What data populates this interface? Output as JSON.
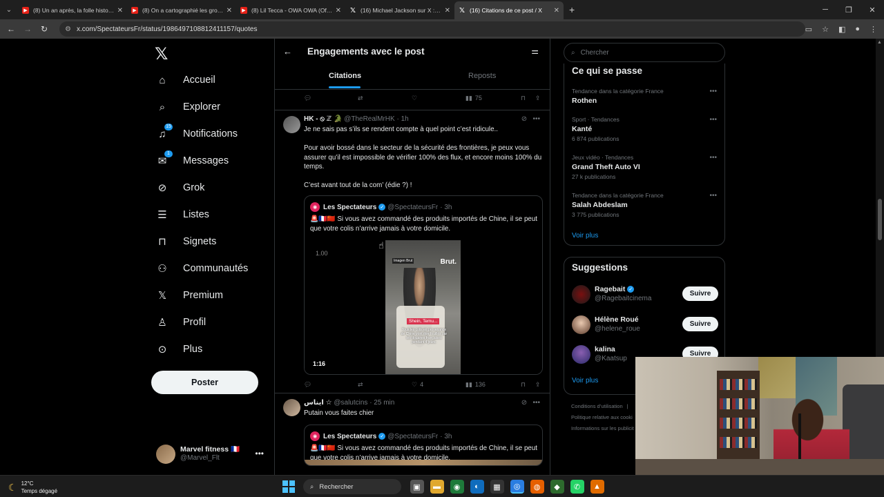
{
  "browser": {
    "tabs": [
      {
        "title": "(8) Un an après, la folle histoire",
        "icon": "youtube-icon"
      },
      {
        "title": "(8) On a cartographié les group",
        "icon": "youtube-icon"
      },
      {
        "title": "(8) Lil Tecca - OWA OWA (Offici",
        "icon": "youtube-icon"
      },
      {
        "title": "(16) Michael Jackson sur X : \"M",
        "icon": "x-icon"
      },
      {
        "title": "(16) Citations de ce post / X",
        "icon": "x-icon"
      }
    ],
    "url": "x.com/SpectateursFr/status/1986497108812411157/quotes"
  },
  "nav": {
    "items": [
      {
        "label": "Accueil",
        "icon": "home-icon"
      },
      {
        "label": "Explorer",
        "icon": "search-icon"
      },
      {
        "label": "Notifications",
        "icon": "bell-icon",
        "badge": "15"
      },
      {
        "label": "Messages",
        "icon": "envelope-icon",
        "badge": "1"
      },
      {
        "label": "Grok",
        "icon": "grok-icon"
      },
      {
        "label": "Listes",
        "icon": "list-icon"
      },
      {
        "label": "Signets",
        "icon": "bookmark-icon"
      },
      {
        "label": "Communautés",
        "icon": "people-icon"
      },
      {
        "label": "Premium",
        "icon": "x-icon"
      },
      {
        "label": "Profil",
        "icon": "person-icon"
      },
      {
        "label": "Plus",
        "icon": "more-circle-icon"
      }
    ],
    "post_button": "Poster",
    "account": {
      "name": "Marvel fitness 🇫🇷",
      "handle": "@Marvel_Flt"
    }
  },
  "header": {
    "title": "Engagements avec le post",
    "tabs": [
      "Citations",
      "Reposts"
    ],
    "active_tab": "Citations"
  },
  "top_actions": {
    "views": "75"
  },
  "posts": [
    {
      "name": "HK - ⦸ ℤ 🐊",
      "handle": "@TheRealMrHK",
      "time": "· 1h",
      "text": [
        "Je ne sais pas s’ils se rendent compte à quel point c’est ridicule..",
        "Pour avoir bossé dans le secteur de la sécurité des frontières, je peux vous assurer qu’il est impossible de vérifier 100% des flux, et encore moins 100% du temps.",
        "C’est avant tout de la com’ (édie ?) !"
      ],
      "quote": {
        "name": "Les Spectateurs",
        "handle": "@SpectateursFr",
        "time": "· 3h",
        "text": "🚨🇫🇷🇨🇳 Si vous avez commandé des produits importés de Chine, il se peut que votre colis n’arrive jamais à votre domicile.",
        "video": {
          "speed": "1.00",
          "duration": "1:16",
          "overlay_brand": "Brut.",
          "overlay_tag": "Shein, Temu...",
          "overlay_small": "Imagen Brut",
          "overlay_caption": "Tous les colis en provenance de Chine vont être fouillés par les douanes françaises pendant 4 jours."
        }
      },
      "stats": {
        "likes": "4",
        "views": "136"
      }
    },
    {
      "name": "ايناس ☆",
      "handle": "@salutcins",
      "time": "· 25 min",
      "text": [
        "Putain vous faites chier"
      ],
      "quote": {
        "name": "Les Spectateurs",
        "handle": "@SpectateursFr",
        "time": "· 3h",
        "text": "🚨🇫🇷🇨🇳 Si vous avez commandé des produits importés de Chine, il se peut que votre colis n’arrive jamais à votre domicile."
      }
    }
  ],
  "right": {
    "search_placeholder": "Chercher",
    "trends_title": "Ce qui se passe",
    "trends": [
      {
        "category": "Tendance dans la catégorie France",
        "name": "Rothen",
        "count": ""
      },
      {
        "category": "Sport · Tendances",
        "name": "Kanté",
        "count": "6 874 publications"
      },
      {
        "category": "Jeux vidéo · Tendances",
        "name": "Grand Theft Auto VI",
        "count": "27 k publications"
      },
      {
        "category": "Tendance dans la catégorie France",
        "name": "Salah Abdeslam",
        "count": "3 775 publications"
      }
    ],
    "show_more": "Voir plus",
    "suggestions_title": "Suggestions",
    "suggestions": [
      {
        "name": "Ragebait",
        "handle": "@Ragebaitcinema",
        "verified": true,
        "button": "Suivre"
      },
      {
        "name": "Hélène Roué",
        "handle": "@helene_roue",
        "verified": false,
        "button": "Suivre"
      },
      {
        "name": "kalina",
        "handle": "@Kaatsup",
        "verified": false,
        "button": "Suivre"
      }
    ],
    "suggestions_more": "Voir plus",
    "footer": [
      "Conditions d’utilisation",
      "|",
      "Politique relative aux cooki",
      "Informations sur les publicit"
    ]
  },
  "taskbar": {
    "temp": "12°C",
    "weather": "Temps dégagé",
    "search": "Rechercher"
  }
}
